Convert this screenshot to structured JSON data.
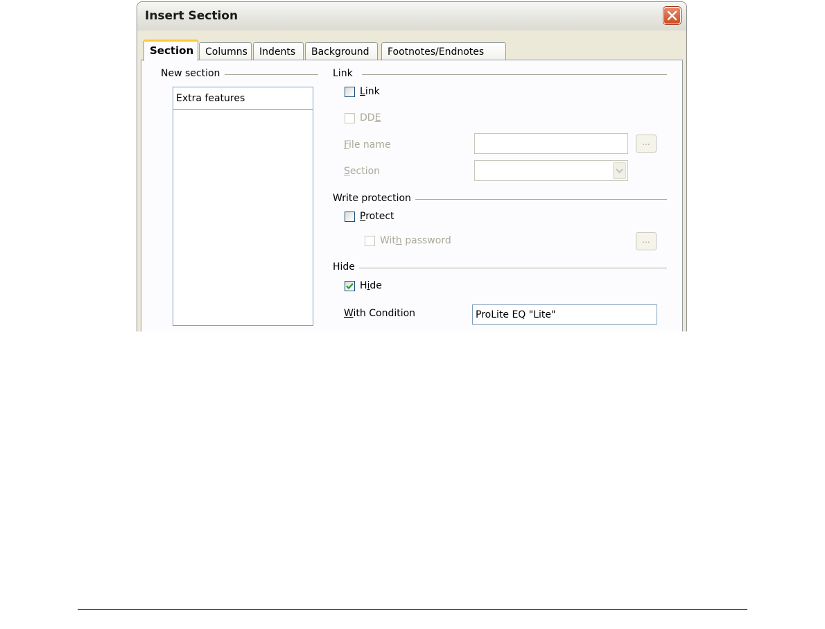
{
  "window": {
    "title": "Insert Section",
    "close_icon": "close-icon"
  },
  "tabs": [
    {
      "label": "Section",
      "active": true
    },
    {
      "label": "Columns",
      "active": false
    },
    {
      "label": "Indents",
      "active": false
    },
    {
      "label": "Background",
      "active": false
    },
    {
      "label": "Footnotes/Endnotes",
      "active": false
    }
  ],
  "new_section": {
    "group_label": "New section",
    "name_value": "Extra features"
  },
  "link": {
    "group_label": "Link",
    "link_checkbox": {
      "label_pre": "",
      "label_key": "L",
      "label_post": "ink",
      "checked": false
    },
    "dde_checkbox": {
      "label_pre": "DD",
      "label_key": "E",
      "label_post": "",
      "checked": false,
      "enabled": false
    },
    "file_name": {
      "label_pre": "",
      "label_key": "F",
      "label_post": "ile name",
      "value": "",
      "enabled": false
    },
    "browse_label": "...",
    "section": {
      "label_pre": "",
      "label_key": "S",
      "label_post": "ection",
      "value": "",
      "enabled": false
    }
  },
  "write_protection": {
    "group_label": "Write protection",
    "protect_checkbox": {
      "label_pre": "",
      "label_key": "P",
      "label_post": "rotect",
      "checked": false
    },
    "password_checkbox": {
      "label_pre": "Wit",
      "label_key": "h",
      "label_post": " password",
      "checked": false,
      "enabled": false
    },
    "browse_label": "..."
  },
  "hide": {
    "group_label": "Hide",
    "hide_checkbox": {
      "label_pre": "H",
      "label_key": "i",
      "label_post": "de",
      "checked": true
    },
    "condition": {
      "label_pre": "",
      "label_key": "W",
      "label_post": "ith Condition",
      "value": "ProLite EQ \"Lite\""
    }
  },
  "colors": {
    "checkmark": "#21a121",
    "close_button": "#d9532b",
    "active_tab_accent": "#ffc83c"
  }
}
